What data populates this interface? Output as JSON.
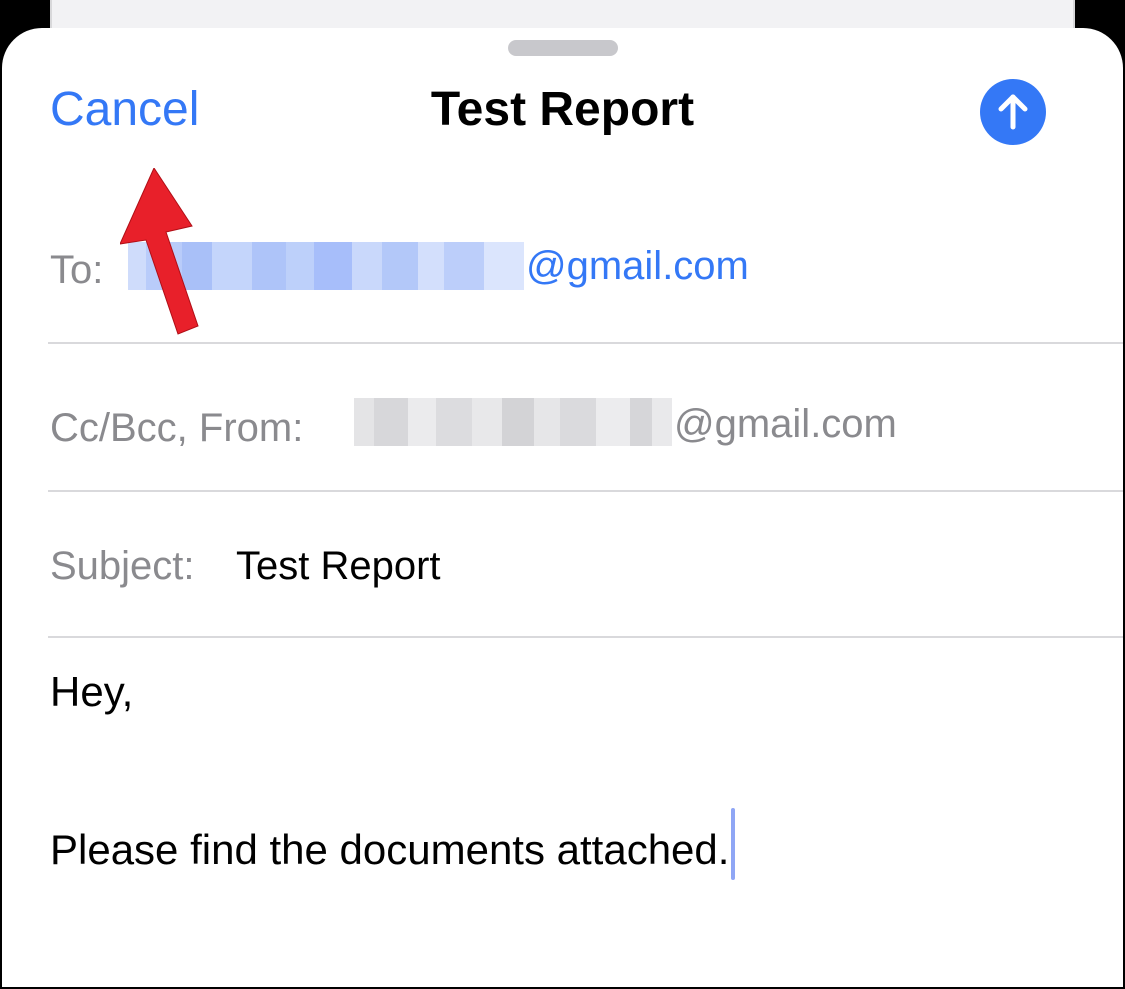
{
  "compose": {
    "cancel_label": "Cancel",
    "title": "Test Report",
    "send_icon": "arrow-up-circle-icon",
    "accent_color": "#3478f6"
  },
  "fields": {
    "to_label": "To:",
    "to_domain": "@gmail.com",
    "cc_label": "Cc/Bcc, From:",
    "from_domain": "@gmail.com",
    "subject_label": "Subject:",
    "subject_value": "Test Report"
  },
  "body": {
    "line1": "Hey,",
    "line2": "Please find the documents attached."
  },
  "annotation": {
    "arrow_color": "#e8202a",
    "arrow_icon": "red-arrow-annotation"
  }
}
